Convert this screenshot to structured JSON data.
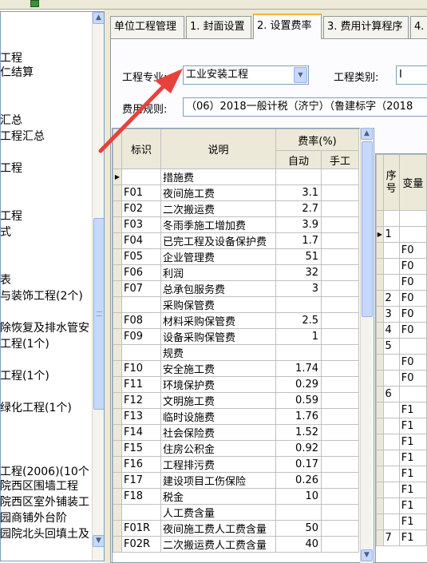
{
  "left_tree": [
    "工程",
    "仁结算",
    "汇总",
    "工程汇总",
    "工程",
    "工程",
    "式",
    "表",
    "与装饰工程(2个)",
    "除恢复及排水管安",
    "工程(1个)",
    "工程(1个)",
    "绿化工程(1个)",
    "工程(2006)(10个",
    "院西区围墙工程",
    "院西区室外铺装工",
    "园商铺外台阶",
    "园院北头回填土及"
  ],
  "tabs": [
    "单位工程管理",
    "1. 封面设置",
    "2. 设置费率",
    "3. 费用计算程序",
    "4."
  ],
  "active_tab": 2,
  "form": {
    "specialty_label": "工程专业:",
    "specialty_value": "工业安装工程",
    "category_label": "工程类别:",
    "category_value": "I",
    "rule_label": "费用规则:",
    "rule_value": "（06）2018一般计税（济宁）（鲁建标字（2018"
  },
  "grid": {
    "headers": {
      "id": "标识",
      "desc": "说明",
      "rate": "费率(%)",
      "auto": "自动",
      "manual": "手工"
    },
    "rows": [
      {
        "id": "",
        "desc": "措施费",
        "auto": "",
        "manual": ""
      },
      {
        "id": "F01",
        "desc": "夜间施工费",
        "auto": "3.1",
        "manual": ""
      },
      {
        "id": "F02",
        "desc": "二次搬运费",
        "auto": "2.7",
        "manual": ""
      },
      {
        "id": "F03",
        "desc": "冬雨季施工增加费",
        "auto": "3.9",
        "manual": ""
      },
      {
        "id": "F04",
        "desc": "已完工程及设备保护费",
        "auto": "1.7",
        "manual": ""
      },
      {
        "id": "F05",
        "desc": "企业管理费",
        "auto": "51",
        "manual": ""
      },
      {
        "id": "F06",
        "desc": "利润",
        "auto": "32",
        "manual": ""
      },
      {
        "id": "F07",
        "desc": "总承包服务费",
        "auto": "3",
        "manual": ""
      },
      {
        "id": "",
        "desc": "采购保管费",
        "auto": "",
        "manual": ""
      },
      {
        "id": "F08",
        "desc": "材料采购保管费",
        "auto": "2.5",
        "manual": ""
      },
      {
        "id": "F09",
        "desc": "设备采购保管费",
        "auto": "1",
        "manual": ""
      },
      {
        "id": "",
        "desc": "规费",
        "auto": "",
        "manual": ""
      },
      {
        "id": "F10",
        "desc": "安全施工费",
        "auto": "1.74",
        "manual": ""
      },
      {
        "id": "F11",
        "desc": "环境保护费",
        "auto": "0.29",
        "manual": ""
      },
      {
        "id": "F12",
        "desc": "文明施工费",
        "auto": "0.59",
        "manual": ""
      },
      {
        "id": "F13",
        "desc": "临时设施费",
        "auto": "1.76",
        "manual": ""
      },
      {
        "id": "F14",
        "desc": "社会保险费",
        "auto": "1.52",
        "manual": ""
      },
      {
        "id": "F15",
        "desc": "住房公积金",
        "auto": "0.92",
        "manual": ""
      },
      {
        "id": "F16",
        "desc": "工程排污费",
        "auto": "0.17",
        "manual": ""
      },
      {
        "id": "F17",
        "desc": "建设项目工伤保险",
        "auto": "0.26",
        "manual": ""
      },
      {
        "id": "F18",
        "desc": "税金",
        "auto": "10",
        "manual": ""
      },
      {
        "id": "",
        "desc": "人工费含量",
        "auto": "",
        "manual": ""
      },
      {
        "id": "F01R",
        "desc": "夜间施工费人工费含量",
        "auto": "50",
        "manual": ""
      },
      {
        "id": "F02R",
        "desc": "二次搬运费人工费含量",
        "auto": "40",
        "manual": ""
      }
    ]
  },
  "right_grid": {
    "headers": {
      "no": "序号",
      "var": "变量"
    },
    "rows": [
      {
        "no": "",
        "var": ""
      },
      {
        "no": "1",
        "var": ""
      },
      {
        "no": "",
        "var": "F0"
      },
      {
        "no": "",
        "var": "F0"
      },
      {
        "no": "",
        "var": "F0"
      },
      {
        "no": "2",
        "var": "F0"
      },
      {
        "no": "3",
        "var": "F0"
      },
      {
        "no": "4",
        "var": "F0"
      },
      {
        "no": "5",
        "var": ""
      },
      {
        "no": "",
        "var": "F0"
      },
      {
        "no": "",
        "var": "F0"
      },
      {
        "no": "6",
        "var": ""
      },
      {
        "no": "",
        "var": "F1"
      },
      {
        "no": "",
        "var": "F1"
      },
      {
        "no": "",
        "var": "F1"
      },
      {
        "no": "",
        "var": "F1"
      },
      {
        "no": "",
        "var": "F1"
      },
      {
        "no": "",
        "var": "F1"
      },
      {
        "no": "",
        "var": "F1"
      },
      {
        "no": "",
        "var": "F1"
      },
      {
        "no": "7",
        "var": "F1"
      }
    ]
  },
  "colors": {
    "annotation_arrow": "#e8413c",
    "active_tab_accent": "#f8b33c",
    "window_bg": "#ece9d8"
  },
  "icons": [
    "chevron-down-icon",
    "chevron-up-icon",
    "red-annotation-arrow-icon",
    "row-pointer-icon"
  ]
}
